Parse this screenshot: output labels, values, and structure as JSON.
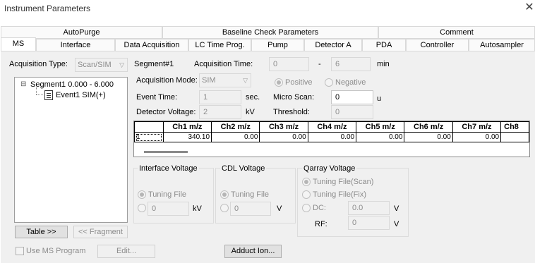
{
  "window": {
    "title": "Instrument Parameters",
    "close_glyph": "✕"
  },
  "tabs_row1": [
    "AutoPurge",
    "Baseline Check Parameters",
    "Comment"
  ],
  "tabs_row2": [
    "MS",
    "Interface",
    "Data Acquisition",
    "LC Time Prog.",
    "Pump",
    "Detector A",
    "PDA",
    "Controller",
    "Autosampler"
  ],
  "active_tab": "MS",
  "acquisition": {
    "type_label": "Acquisition Type:",
    "type_value": "Scan/SIM",
    "segment_label": "Segment#1",
    "time_label": "Acquisition Time:",
    "time_start": "0",
    "time_sep": "-",
    "time_end": "6",
    "time_unit": "min",
    "mode_label": "Acquisition Mode:",
    "mode_value": "SIM",
    "positive_label": "Positive",
    "negative_label": "Negative",
    "event_time_label": "Event Time:",
    "event_time_value": "1",
    "event_time_unit": "sec.",
    "micro_scan_label": "Micro Scan:",
    "micro_scan_value": "0",
    "micro_scan_unit": "u",
    "detector_voltage_label": "Detector Voltage:",
    "detector_voltage_value": "2",
    "detector_voltage_unit": "kV",
    "threshold_label": "Threshold:",
    "threshold_value": "0"
  },
  "tree": {
    "expander": "⊟",
    "segment": "Segment1 0.000 - 6.000",
    "event": "Event1 SIM(+)"
  },
  "grid": {
    "headers": [
      "Ch1 m/z",
      "Ch2 m/z",
      "Ch3 m/z",
      "Ch4 m/z",
      "Ch5 m/z",
      "Ch6 m/z",
      "Ch7 m/z",
      "Ch8"
    ],
    "row_label": "1",
    "values": [
      "340.10",
      "0.00",
      "0.00",
      "0.00",
      "0.00",
      "0.00",
      "0.00",
      ""
    ]
  },
  "interface_voltage": {
    "title": "Interface Voltage",
    "tuning_file": "Tuning File",
    "value": "0",
    "unit": "kV"
  },
  "cdl_voltage": {
    "title": "CDL Voltage",
    "tuning_file": "Tuning File",
    "value": "0",
    "unit": "V"
  },
  "qarray_voltage": {
    "title": "Qarray Voltage",
    "tuning_scan": "Tuning File(Scan)",
    "tuning_fix": "Tuning File(Fix)",
    "dc_label": "DC:",
    "dc_value": "0.0",
    "dc_unit": "V",
    "rf_label": "RF:",
    "rf_value": "0",
    "rf_unit": "V"
  },
  "buttons": {
    "table": "Table >>",
    "fragment": "<< Fragment",
    "use_ms_program": "Use MS Program",
    "edit": "Edit...",
    "adduct_ion": "Adduct Ion..."
  }
}
